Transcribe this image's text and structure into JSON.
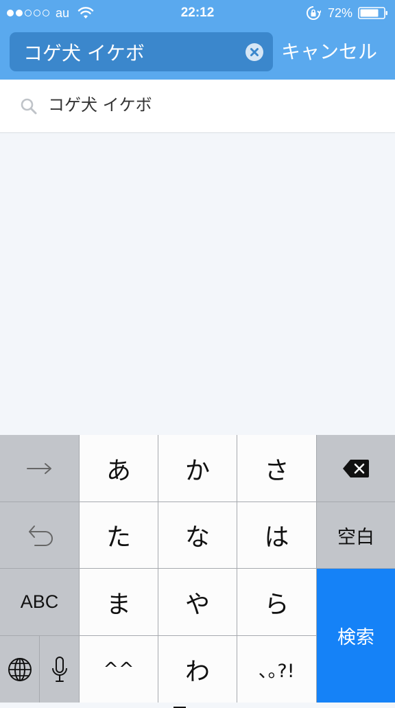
{
  "status_bar": {
    "carrier": "au",
    "time": "22:12",
    "battery": "72%"
  },
  "search": {
    "query": "コゲ犬 イケボ",
    "cancel_label": "キャンセル"
  },
  "suggestions": [
    {
      "text": "コゲ犬 イケボ"
    }
  ],
  "keyboard": {
    "row1": [
      "あ",
      "か",
      "さ"
    ],
    "row2": [
      "た",
      "な",
      "は"
    ],
    "row3": [
      "ま",
      "や",
      "ら"
    ],
    "row4": [
      "^^",
      "わ",
      "､｡?!"
    ],
    "space_label": "空白",
    "abc_label": "ABC",
    "search_label": "検索"
  },
  "colors": {
    "header": "#5aa9ee",
    "search_field": "#3b87cc",
    "search_key": "#1582f7"
  }
}
